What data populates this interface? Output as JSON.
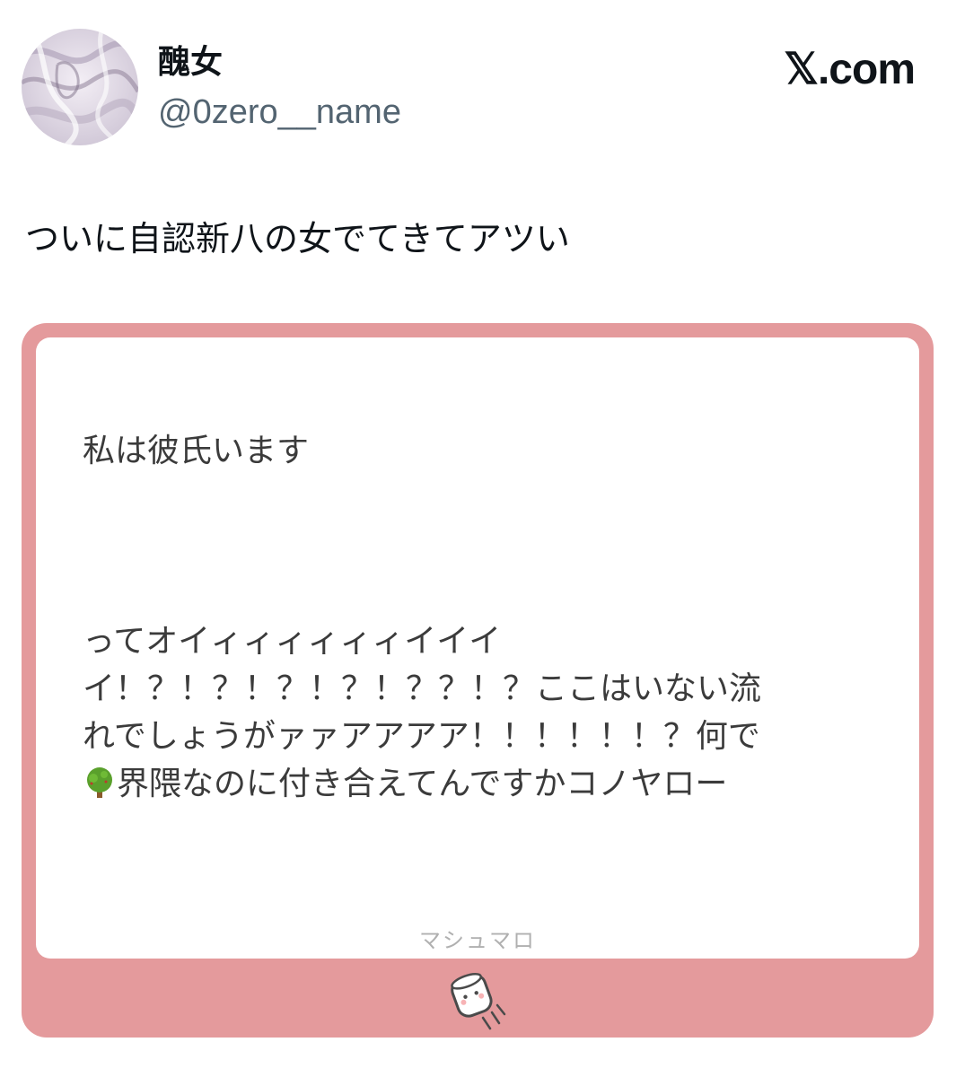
{
  "author": {
    "display_name": "醜女",
    "handle": "@0zero__name"
  },
  "brand": "𝕏.com",
  "tweet": {
    "text": "ついに自認新八の女でてきてアツい"
  },
  "card": {
    "question_line1": "私は彼氏います",
    "question_line2": "ってオイィィィィィィイイイ",
    "question_line3": "イ！？！？！？！？！？？！？ここはいない流",
    "question_line4": "れでしょうがァァアアアア！！！！！！？何で",
    "question_line5": "界隈なのに付き合えてんですかコノヤロー",
    "service_label": "マシュマロ",
    "icons": [
      "tree-emoji-icon",
      "marshmallow-icon"
    ],
    "accent_color": "#e49a9c"
  }
}
